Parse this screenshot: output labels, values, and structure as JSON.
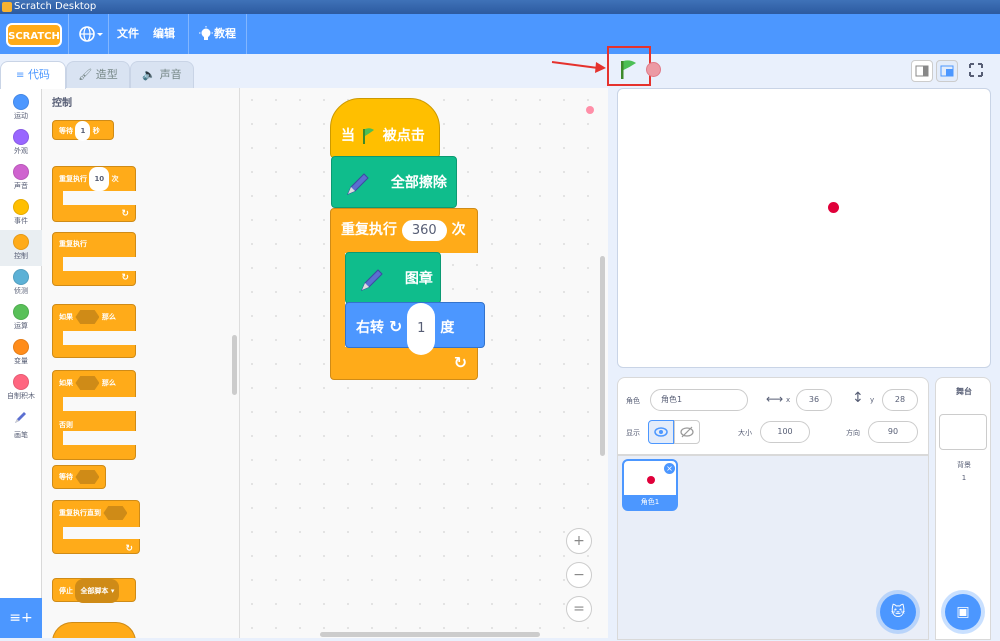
{
  "window": {
    "title": "Scratch Desktop"
  },
  "menubar": {
    "logo": "SCRATCH",
    "file": "文件",
    "edit": "编辑",
    "tutorials": "教程"
  },
  "tabs": {
    "code": "代码",
    "costumes": "造型",
    "sounds": "声音"
  },
  "categories": [
    {
      "label": "运动",
      "color": "#4c97ff"
    },
    {
      "label": "外观",
      "color": "#9966ff"
    },
    {
      "label": "声音",
      "color": "#cf63cf"
    },
    {
      "label": "事件",
      "color": "#ffbf00"
    },
    {
      "label": "控制",
      "color": "#ffab19"
    },
    {
      "label": "侦测",
      "color": "#5cb1d6"
    },
    {
      "label": "运算",
      "color": "#59c059"
    },
    {
      "label": "变量",
      "color": "#ff8c1a"
    },
    {
      "label": "自制积木",
      "color": "#ff6680"
    },
    {
      "label": "画笔",
      "color": "#0fbd8c"
    }
  ],
  "palette": {
    "title": "控制",
    "wait_label": "等待",
    "wait_value": "1",
    "wait_unit": "秒",
    "repeat_label": "重复执行",
    "repeat_value": "10",
    "repeat_unit": "次",
    "forever_label": "重复执行",
    "if_label": "如果",
    "then_label": "那么",
    "if2_label": "如果",
    "then2_label": "那么",
    "else_label": "否则",
    "wait_until_label": "等待",
    "repeat_until_label": "重复执行直到",
    "stop_label": "停止",
    "stop_value": "全部脚本 ▾"
  },
  "script": {
    "when_label": "当",
    "clicked_label": "被点击",
    "clear_label": "全部擦除",
    "repeat_label": "重复执行",
    "repeat_value": "360",
    "repeat_unit": "次",
    "stamp_label": "图章",
    "turn_label": "右转",
    "turn_value": "1",
    "turn_unit": "度"
  },
  "zoom": {
    "in": "+",
    "out": "−",
    "reset": "="
  },
  "sprite_info": {
    "sprite_label": "角色",
    "sprite_name": "角色1",
    "x_label": "x",
    "x_value": "36",
    "y_label": "y",
    "y_value": "28",
    "show_label": "显示",
    "size_label": "大小",
    "size_value": "100",
    "direction_label": "方向",
    "direction_value": "90"
  },
  "sprite_list": [
    {
      "name": "角色1"
    }
  ],
  "stage_panel": {
    "title": "舞台",
    "backdrops_label": "背景",
    "backdrops_count": "1"
  },
  "colors": {
    "accent": "#4c97ff",
    "control": "#ffab19",
    "pen": "#0fbd8c",
    "motion": "#4c97ff",
    "sprite_dot": "#e0003a",
    "annotation": "#e5322d"
  }
}
